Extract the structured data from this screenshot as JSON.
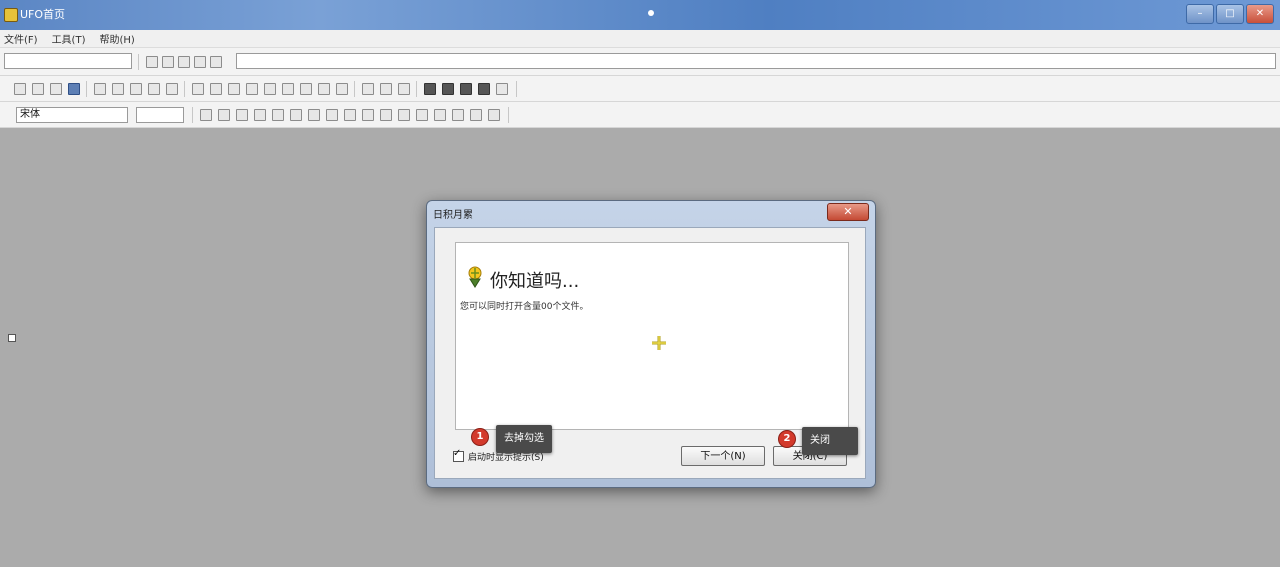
{
  "window": {
    "title": "UFO首页",
    "controls": {
      "minimize": "–",
      "maximize": "□",
      "close": "✕"
    }
  },
  "menu": {
    "items": [
      "文件(F)",
      "工具(T)",
      "帮助(H)"
    ]
  },
  "format_bar": {
    "font_value": "宋体"
  },
  "dialog": {
    "title": "日积月累",
    "close_glyph": "✕",
    "tip_heading": "你知道吗...",
    "tip_text": "您可以同时打开含量00个文件。",
    "show_tips_label": "启动时显示提示(S)",
    "next_button": "下一个(N)",
    "close_button": "关闭(C)"
  },
  "annotations": [
    {
      "number": "1",
      "label": "去掉勾选"
    },
    {
      "number": "2",
      "label": "关闭"
    }
  ],
  "icons": {
    "app": "app-icon",
    "tip": "lightbulb-icon",
    "cursor": "move-cross-icon"
  },
  "colors": {
    "workspace": "#ababab",
    "titlebar": "#5b86c4",
    "annotation_badge": "#d33a2c",
    "annotation_bg": "#4a4a4a"
  }
}
